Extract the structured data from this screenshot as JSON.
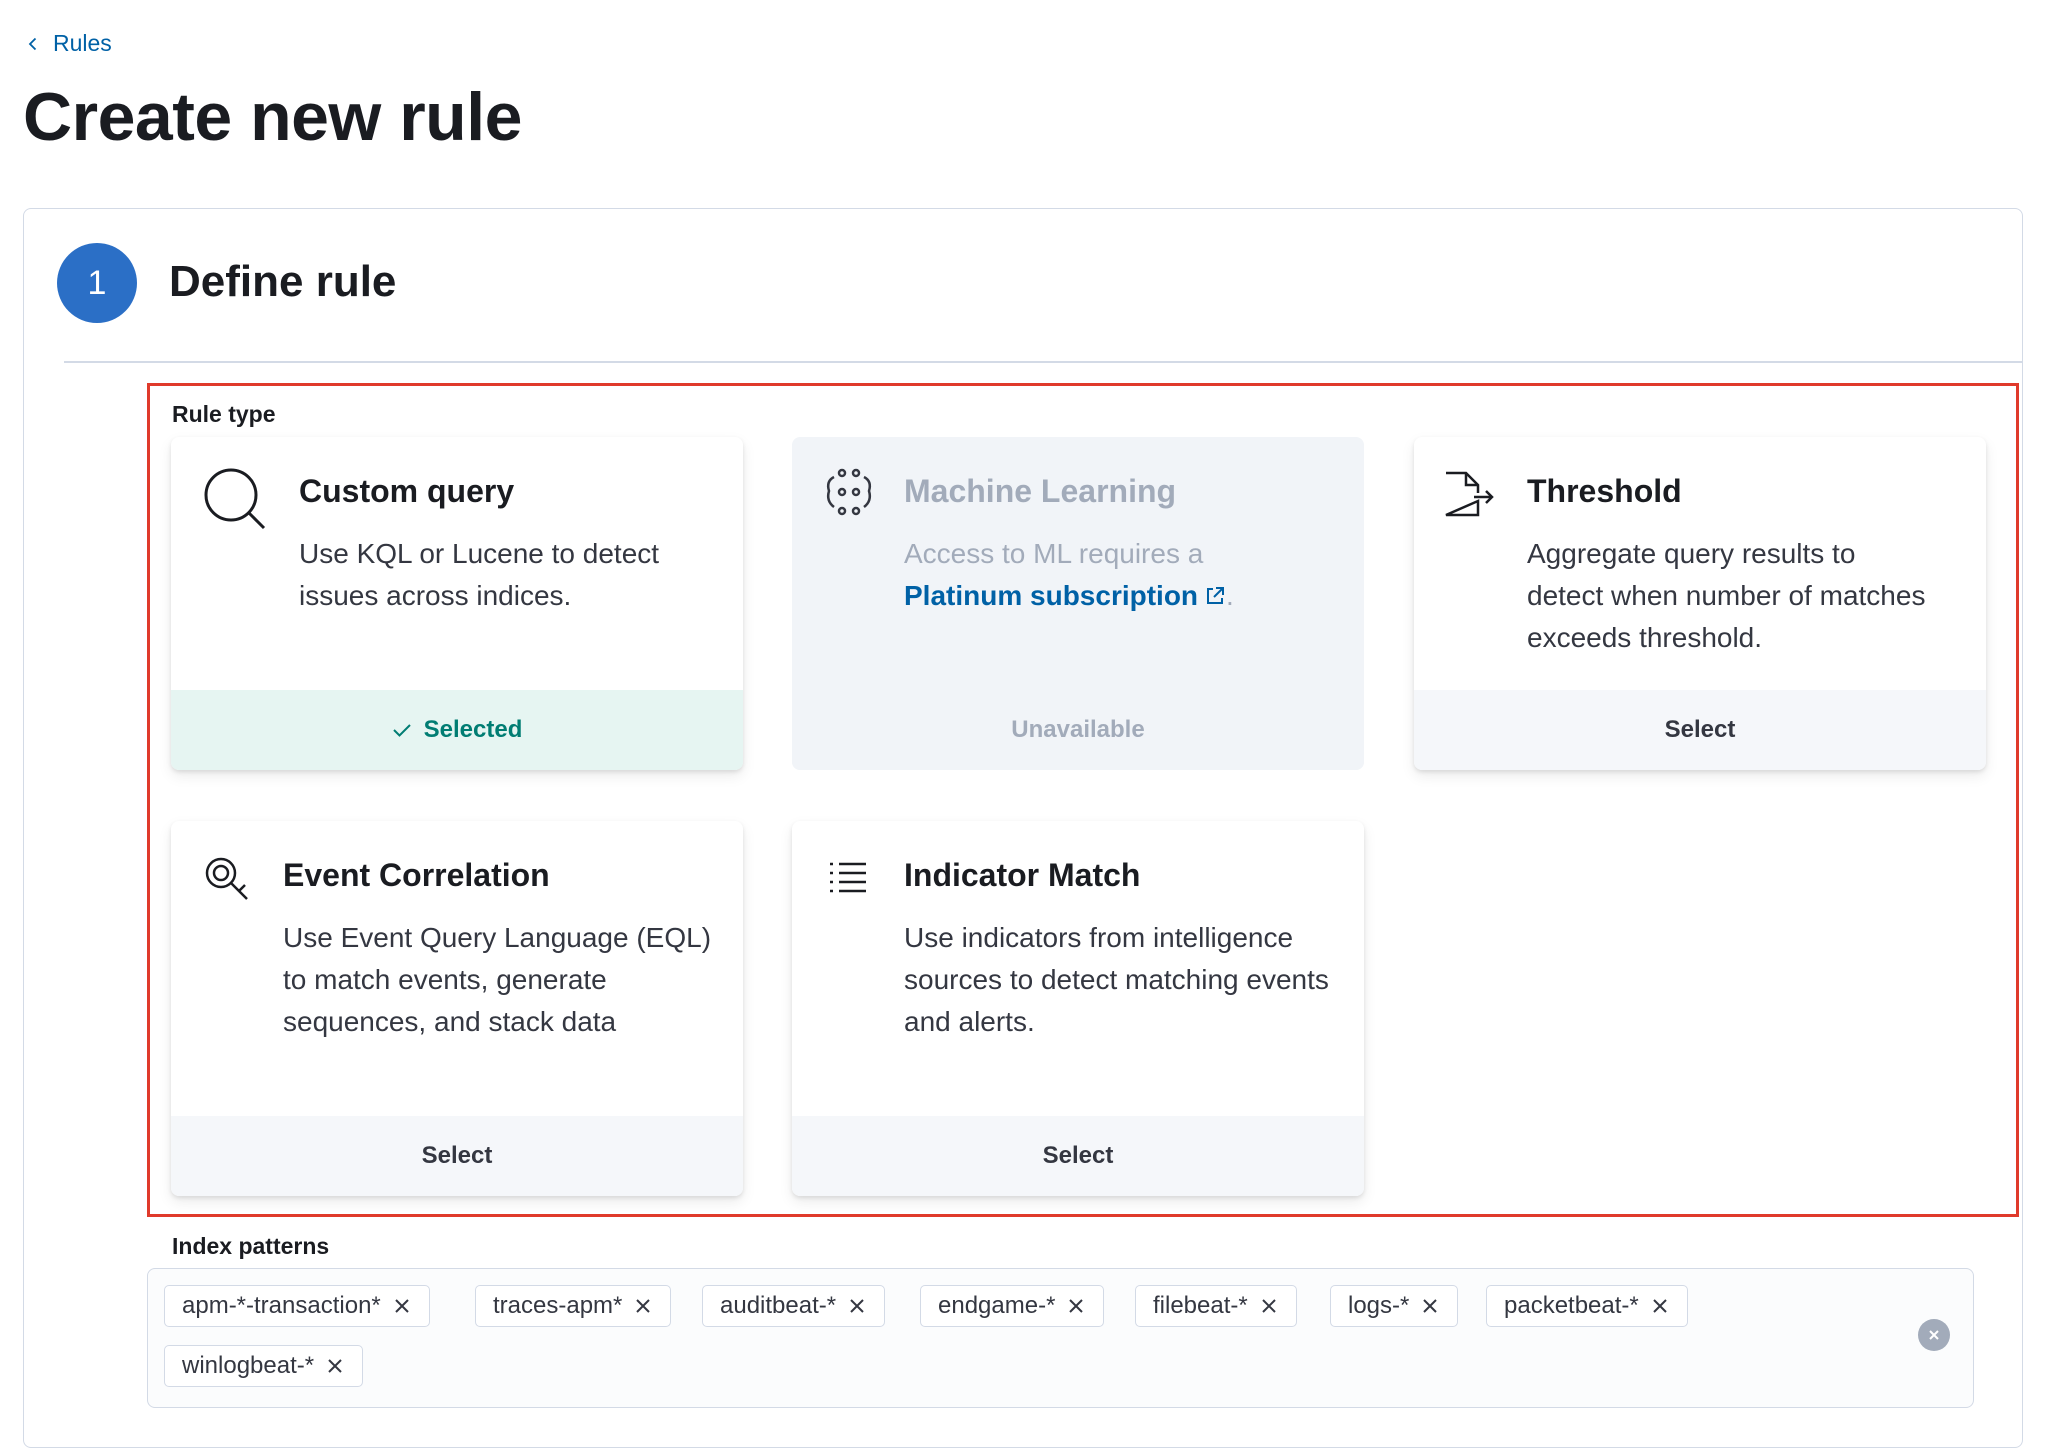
{
  "breadcrumb": {
    "back_label": "Rules"
  },
  "page": {
    "title": "Create new rule"
  },
  "step": {
    "number": "1",
    "title": "Define rule"
  },
  "rule_type": {
    "label": "Rule type",
    "cards": [
      {
        "title": "Custom query",
        "description": "Use KQL or Lucene to detect issues across indices.",
        "footer": "Selected",
        "state": "selected",
        "icon": "search-icon"
      },
      {
        "title": "Machine Learning",
        "description": "Access to ML requires a",
        "link": "Platinum subscription",
        "link_suffix": ".",
        "footer": "Unavailable",
        "state": "disabled",
        "icon": "machine-learning-icon"
      },
      {
        "title": "Threshold",
        "description": "Aggregate query results to detect when number of matches exceeds threshold.",
        "footer": "Select",
        "state": "default",
        "icon": "threshold-icon"
      },
      {
        "title": "Event Correlation",
        "description": "Use Event Query Language (EQL) to match events, generate sequences, and stack data",
        "footer": "Select",
        "state": "default",
        "icon": "eql-icon"
      },
      {
        "title": "Indicator Match",
        "description": "Use indicators from intelligence sources to detect matching events and alerts.",
        "footer": "Select",
        "state": "default",
        "icon": "list-icon"
      }
    ]
  },
  "index_patterns": {
    "label": "Index patterns",
    "items": [
      "apm-*-transaction*",
      "traces-apm*",
      "auditbeat-*",
      "endgame-*",
      "filebeat-*",
      "logs-*",
      "packetbeat-*",
      "winlogbeat-*"
    ]
  },
  "colors": {
    "accent": "#2b6fc6",
    "link": "#0061a6",
    "selected": "#017d73",
    "highlight_border": "#e03a2b"
  }
}
